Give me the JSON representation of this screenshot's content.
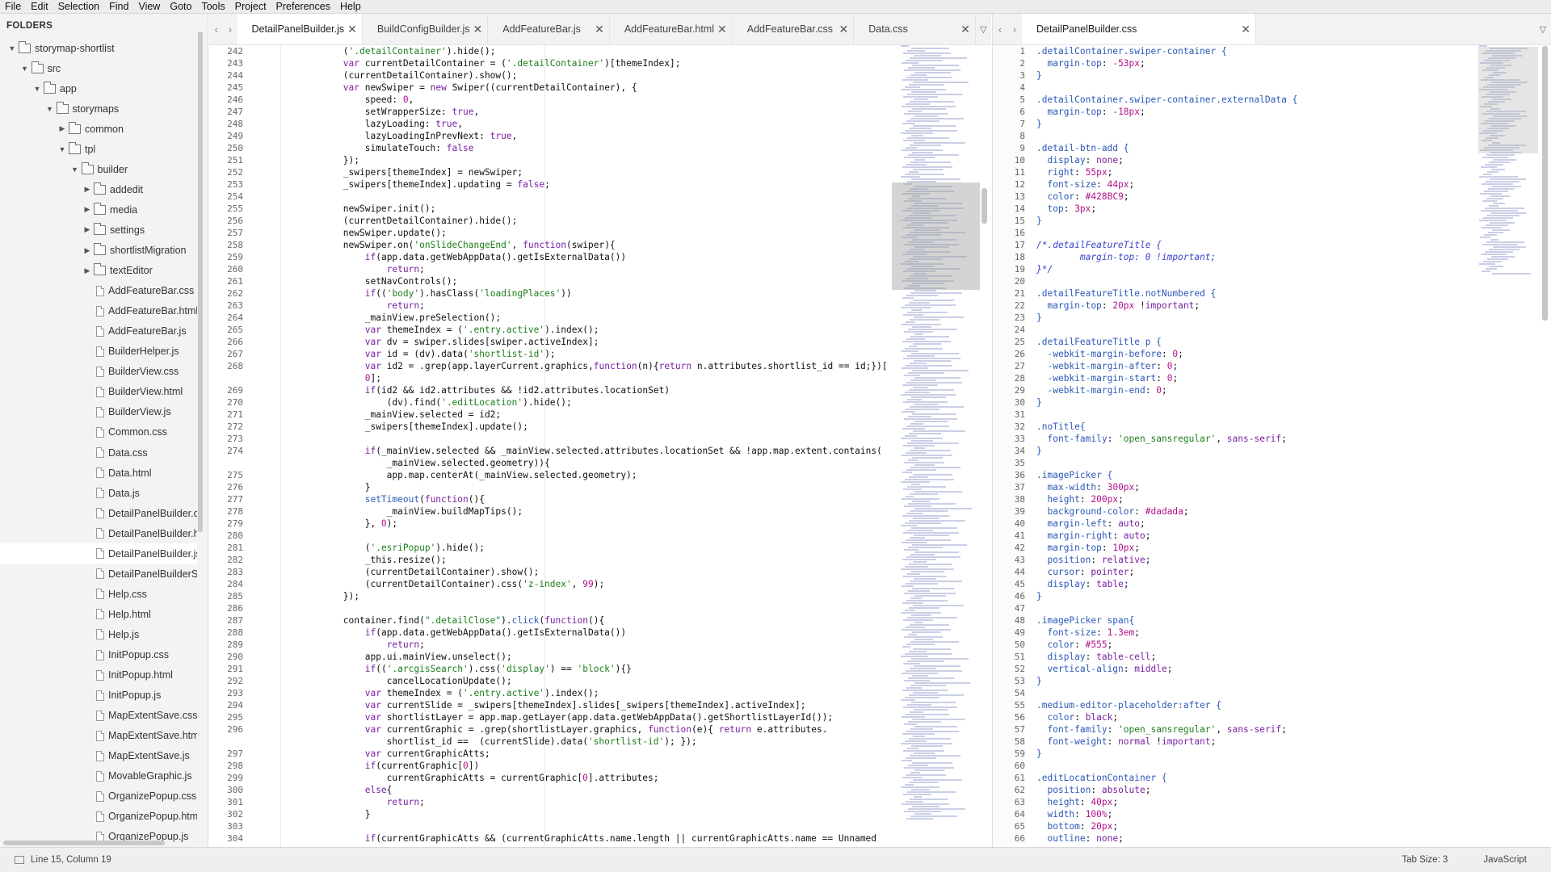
{
  "menu": [
    "File",
    "Edit",
    "Selection",
    "Find",
    "View",
    "Goto",
    "Tools",
    "Project",
    "Preferences",
    "Help"
  ],
  "sidebar": {
    "header": "FOLDERS",
    "tree": [
      {
        "label": "storymap-shortlist",
        "depth": 0,
        "type": "folder",
        "open": true
      },
      {
        "label": "src",
        "depth": 1,
        "type": "folder",
        "open": true
      },
      {
        "label": "app",
        "depth": 2,
        "type": "folder",
        "open": true
      },
      {
        "label": "storymaps",
        "depth": 3,
        "type": "folder",
        "open": true
      },
      {
        "label": "common",
        "depth": 4,
        "type": "folder",
        "open": false
      },
      {
        "label": "tpl",
        "depth": 4,
        "type": "folder",
        "open": true
      },
      {
        "label": "builder",
        "depth": 5,
        "type": "folder",
        "open": true
      },
      {
        "label": "addedit",
        "depth": 6,
        "type": "folder",
        "open": false
      },
      {
        "label": "media",
        "depth": 6,
        "type": "folder",
        "open": false
      },
      {
        "label": "settings",
        "depth": 6,
        "type": "folder",
        "open": false
      },
      {
        "label": "shortlistMigration",
        "depth": 6,
        "type": "folder",
        "open": false
      },
      {
        "label": "textEditor",
        "depth": 6,
        "type": "folder",
        "open": false
      },
      {
        "label": "AddFeatureBar.css",
        "depth": 6,
        "type": "file"
      },
      {
        "label": "AddFeatureBar.html",
        "depth": 6,
        "type": "file"
      },
      {
        "label": "AddFeatureBar.js",
        "depth": 6,
        "type": "file"
      },
      {
        "label": "BuilderHelper.js",
        "depth": 6,
        "type": "file"
      },
      {
        "label": "BuilderView.css",
        "depth": 6,
        "type": "file"
      },
      {
        "label": "BuilderView.html",
        "depth": 6,
        "type": "file"
      },
      {
        "label": "BuilderView.js",
        "depth": 6,
        "type": "file"
      },
      {
        "label": "Common.css",
        "depth": 6,
        "type": "file"
      },
      {
        "label": "Data.css",
        "depth": 6,
        "type": "file"
      },
      {
        "label": "Data.html",
        "depth": 6,
        "type": "file"
      },
      {
        "label": "Data.js",
        "depth": 6,
        "type": "file"
      },
      {
        "label": "DetailPanelBuilder.css",
        "depth": 6,
        "type": "file"
      },
      {
        "label": "DetailPanelBuilder.html",
        "depth": 6,
        "type": "file"
      },
      {
        "label": "DetailPanelBuilder.js",
        "depth": 6,
        "type": "file",
        "selected": true
      },
      {
        "label": "DetailPanelBuilderSlide",
        "depth": 6,
        "type": "file"
      },
      {
        "label": "Help.css",
        "depth": 6,
        "type": "file"
      },
      {
        "label": "Help.html",
        "depth": 6,
        "type": "file"
      },
      {
        "label": "Help.js",
        "depth": 6,
        "type": "file"
      },
      {
        "label": "InitPopup.css",
        "depth": 6,
        "type": "file"
      },
      {
        "label": "InitPopup.html",
        "depth": 6,
        "type": "file"
      },
      {
        "label": "InitPopup.js",
        "depth": 6,
        "type": "file"
      },
      {
        "label": "MapExtentSave.css",
        "depth": 6,
        "type": "file"
      },
      {
        "label": "MapExtentSave.html",
        "depth": 6,
        "type": "file"
      },
      {
        "label": "MapExtentSave.js",
        "depth": 6,
        "type": "file"
      },
      {
        "label": "MovableGraphic.js",
        "depth": 6,
        "type": "file"
      },
      {
        "label": "OrganizePopup.css",
        "depth": 6,
        "type": "file"
      },
      {
        "label": "OrganizePopup.html",
        "depth": 6,
        "type": "file"
      },
      {
        "label": "OrganizePopup.js",
        "depth": 6,
        "type": "file"
      }
    ]
  },
  "left_tabs": [
    {
      "label": "DetailPanelBuilder.js",
      "active": true
    },
    {
      "label": "BuildConfigBuilder.js",
      "active": false
    },
    {
      "label": "AddFeatureBar.js",
      "active": false
    },
    {
      "label": "AddFeatureBar.html",
      "active": false
    },
    {
      "label": "AddFeatureBar.css",
      "active": false
    },
    {
      "label": "Data.css",
      "active": false
    }
  ],
  "right_tabs": [
    {
      "label": "DetailPanelBuilder.css",
      "active": true
    }
  ],
  "left_code": [
    [
      "242",
      "\t\t\t\t$('.detailContainer').hide();"
    ],
    [
      "243",
      "\t\t\t\tvar currentDetailContainer = $('.detailContainer')[themeIndex];"
    ],
    [
      "244",
      "\t\t\t\t$(currentDetailContainer).show();"
    ],
    [
      "245",
      "\t\t\t\tvar newSwiper = new Swiper($(currentDetailContainer), {"
    ],
    [
      "246",
      "\t\t\t\t\tspeed: 0,"
    ],
    [
      "247",
      "\t\t\t\t\tsetWrapperSize: true,"
    ],
    [
      "248",
      "\t\t\t\t\tlazyLoading: true,"
    ],
    [
      "249",
      "\t\t\t\t\tlazyLoadingInPrevNext: true,"
    ],
    [
      "250",
      "\t\t\t\t\tsimulateTouch: false"
    ],
    [
      "251",
      "\t\t\t\t});"
    ],
    [
      "252",
      "\t\t\t\t_swipers[themeIndex] = newSwiper;"
    ],
    [
      "253",
      "\t\t\t\t_swipers[themeIndex].updating = false;"
    ],
    [
      "254",
      ""
    ],
    [
      "255",
      "\t\t\t\tnewSwiper.init();"
    ],
    [
      "256",
      "\t\t\t\t$(currentDetailContainer).hide();"
    ],
    [
      "257",
      "\t\t\t\tnewSwiper.update();"
    ],
    [
      "258",
      "\t\t\t\tnewSwiper.on('onSlideChangeEnd', function(swiper){"
    ],
    [
      "259",
      "\t\t\t\t\tif(app.data.getWebAppData().getIsExternalData())"
    ],
    [
      "260",
      "\t\t\t\t\t\treturn;"
    ],
    [
      "261",
      "\t\t\t\t\tsetNavControls();"
    ],
    [
      "262",
      "\t\t\t\t\tif($('body').hasClass('loadingPlaces'))"
    ],
    [
      "263",
      "\t\t\t\t\t\treturn;"
    ],
    [
      "264",
      "\t\t\t\t\t_mainView.preSelection();"
    ],
    [
      "265",
      "\t\t\t\t\tvar themeIndex = $('.entry.active').index();"
    ],
    [
      "266",
      "\t\t\t\t\tvar dv = swiper.slides[swiper.activeIndex];"
    ],
    [
      "267",
      "\t\t\t\t\tvar id = $(dv).data('shortlist-id');"
    ],
    [
      "268",
      "\t\t\t\t\tvar id2 = $.grep(app.layerCurrent.graphics,function(n){return n.attributes.shortlist_id == id;})["
    ],
    [
      "",
      "\t\t\t\t\t0];"
    ],
    [
      "269",
      "\t\t\t\t\tif(id2 && id2.attributes && !id2.attributes.locationSet)"
    ],
    [
      "270",
      "\t\t\t\t\t\t$(dv).find('.editLocation').hide();"
    ],
    [
      "271",
      "\t\t\t\t\t_mainView.selected = id2;"
    ],
    [
      "272",
      "\t\t\t\t\t_swipers[themeIndex].update();"
    ],
    [
      "273",
      ""
    ],
    [
      "274",
      "\t\t\t\t\tif(_mainView.selected && _mainView.selected.attributes.locationSet && !app.map.extent.contains("
    ],
    [
      "",
      "\t\t\t\t\t\t_mainView.selected.geometry)){"
    ],
    [
      "275",
      "\t\t\t\t\t\tapp.map.centerAt(_mainView.selected.geometry);"
    ],
    [
      "276",
      "\t\t\t\t\t}"
    ],
    [
      "277",
      "\t\t\t\t\tsetTimeout(function(){"
    ],
    [
      "278",
      "\t\t\t\t\t\t_mainView.buildMapTips();"
    ],
    [
      "279",
      "\t\t\t\t\t}, 0);"
    ],
    [
      "280",
      ""
    ],
    [
      "281",
      "\t\t\t\t\t$('.esriPopup').hide();"
    ],
    [
      "282",
      "\t\t\t\t\t_this.resize();"
    ],
    [
      "283",
      "\t\t\t\t\t$(currentDetailContainer).show();"
    ],
    [
      "284",
      "\t\t\t\t\t$(currentDetailContainer).css('z-index', 99);"
    ],
    [
      "285",
      "\t\t\t\t});"
    ],
    [
      "286",
      ""
    ],
    [
      "287",
      "\t\t\t\tcontainer.find(\".detailClose\").click(function(){"
    ],
    [
      "288",
      "\t\t\t\t\tif(app.data.getWebAppData().getIsExternalData())"
    ],
    [
      "289",
      "\t\t\t\t\t\treturn;"
    ],
    [
      "290",
      "\t\t\t\t\tapp.ui.mainView.unselect();"
    ],
    [
      "291",
      "\t\t\t\t\tif($('.arcgisSearch').css('display') == 'block'){}"
    ],
    [
      "292",
      "\t\t\t\t\t\tcancelLocationUpdate();"
    ],
    [
      "293",
      "\t\t\t\t\tvar themeIndex = $('.entry.active').index();"
    ],
    [
      "294",
      "\t\t\t\t\tvar currentSlide = _swipers[themeIndex].slides[_swipers[themeIndex].activeIndex];"
    ],
    [
      "295",
      "\t\t\t\t\tvar shortlistLayer = app.map.getLayer(app.data.getWebAppData().getShortlistLayerId());"
    ],
    [
      "296",
      "\t\t\t\t\tvar currentGraphic = $.grep(shortlistLayer.graphics, function(e){ return e.attributes."
    ],
    [
      "",
      "\t\t\t\t\t\tshortlist_id ==  $(currentSlide).data('shortlist-id'); });"
    ],
    [
      "297",
      "\t\t\t\t\tvar currentGraphicAtts;"
    ],
    [
      "298",
      "\t\t\t\t\tif(currentGraphic[0])"
    ],
    [
      "299",
      "\t\t\t\t\t\tcurrentGraphicAtts = currentGraphic[0].attributes;"
    ],
    [
      "300",
      "\t\t\t\t\telse{"
    ],
    [
      "301",
      "\t\t\t\t\t\treturn;"
    ],
    [
      "302",
      "\t\t\t\t\t}"
    ],
    [
      "303",
      ""
    ],
    [
      "304",
      "\t\t\t\t\tif(currentGraphicAtts && (currentGraphicAtts.name.length || currentGraphicAtts.name == \"Unnamed"
    ]
  ],
  "right_code": [
    [
      "1",
      ".detailContainer.swiper-container {"
    ],
    [
      "2",
      "\tmargin-top: -53px;"
    ],
    [
      "3",
      "}"
    ],
    [
      "4",
      ""
    ],
    [
      "5",
      ".detailContainer.swiper-container.externalData {"
    ],
    [
      "6",
      "\tmargin-top: -18px;"
    ],
    [
      "7",
      "}"
    ],
    [
      "8",
      ""
    ],
    [
      "9",
      ".detail-btn-add {"
    ],
    [
      "10",
      "\tdisplay: none;"
    ],
    [
      "11",
      "\tright: 55px;"
    ],
    [
      "12",
      "\tfont-size: 44px;"
    ],
    [
      "13",
      "\tcolor: #428BC9;"
    ],
    [
      "14",
      "\ttop: 3px;"
    ],
    [
      "15",
      "}"
    ],
    [
      "16",
      ""
    ],
    [
      "17",
      "/*.detailFeatureTitle {"
    ],
    [
      "18",
      "\tmargin-top: 0 !important;"
    ],
    [
      "19",
      "}*/"
    ],
    [
      "20",
      ""
    ],
    [
      "21",
      ".detailFeatureTitle.notNumbered {"
    ],
    [
      "22",
      "\tmargin-top: 20px !important;"
    ],
    [
      "23",
      "}"
    ],
    [
      "24",
      ""
    ],
    [
      "25",
      ".detailFeatureTitle p {"
    ],
    [
      "26",
      "\t-webkit-margin-before: 0;"
    ],
    [
      "27",
      "\t-webkit-margin-after: 0;"
    ],
    [
      "28",
      "\t-webkit-margin-start: 0;"
    ],
    [
      "29",
      "\t-webkit-margin-end: 0;"
    ],
    [
      "30",
      "}"
    ],
    [
      "31",
      ""
    ],
    [
      "32",
      ".noTitle{"
    ],
    [
      "33",
      "\tfont-family: 'open_sansregular', sans-serif;"
    ],
    [
      "34",
      "}"
    ],
    [
      "35",
      ""
    ],
    [
      "36",
      ".imagePicker {"
    ],
    [
      "37",
      "\tmax-width: 300px;"
    ],
    [
      "38",
      "\theight: 200px;"
    ],
    [
      "39",
      "\tbackground-color: #dadada;"
    ],
    [
      "40",
      "\tmargin-left: auto;"
    ],
    [
      "41",
      "\tmargin-right: auto;"
    ],
    [
      "42",
      "\tmargin-top: 10px;"
    ],
    [
      "43",
      "\tposition: relative;"
    ],
    [
      "44",
      "\tcursor: pointer;"
    ],
    [
      "45",
      "\tdisplay: table;"
    ],
    [
      "46",
      "}"
    ],
    [
      "47",
      ""
    ],
    [
      "48",
      ".imagePicker span{"
    ],
    [
      "49",
      "\tfont-size: 1.3em;"
    ],
    [
      "50",
      "\tcolor: #555;"
    ],
    [
      "51",
      "\tdisplay: table-cell;"
    ],
    [
      "52",
      "\tvertical-align: middle;"
    ],
    [
      "53",
      "}"
    ],
    [
      "54",
      ""
    ],
    [
      "55",
      ".medium-editor-placeholder:after {"
    ],
    [
      "56",
      "\tcolor: black;"
    ],
    [
      "57",
      "\tfont-family: 'open_sansregular', sans-serif;"
    ],
    [
      "58",
      "\tfont-weight: normal !important;"
    ],
    [
      "59",
      "}"
    ],
    [
      "60",
      ""
    ],
    [
      "61",
      ".editLocationContainer {"
    ],
    [
      "62",
      "\tposition: absolute;"
    ],
    [
      "63",
      "\theight: 40px;"
    ],
    [
      "64",
      "\twidth: 100%;"
    ],
    [
      "65",
      "\tbottom: 20px;"
    ],
    [
      "66",
      "\toutline: none;"
    ]
  ],
  "status": {
    "position": "Line 15, Column 19",
    "tab_size": "Tab Size: 3",
    "syntax": "JavaScript"
  },
  "colors": {
    "keyword": "#7a1fa2",
    "string": "#1d7d1d",
    "number": "#b2118a",
    "comment": "#3a43c9"
  }
}
